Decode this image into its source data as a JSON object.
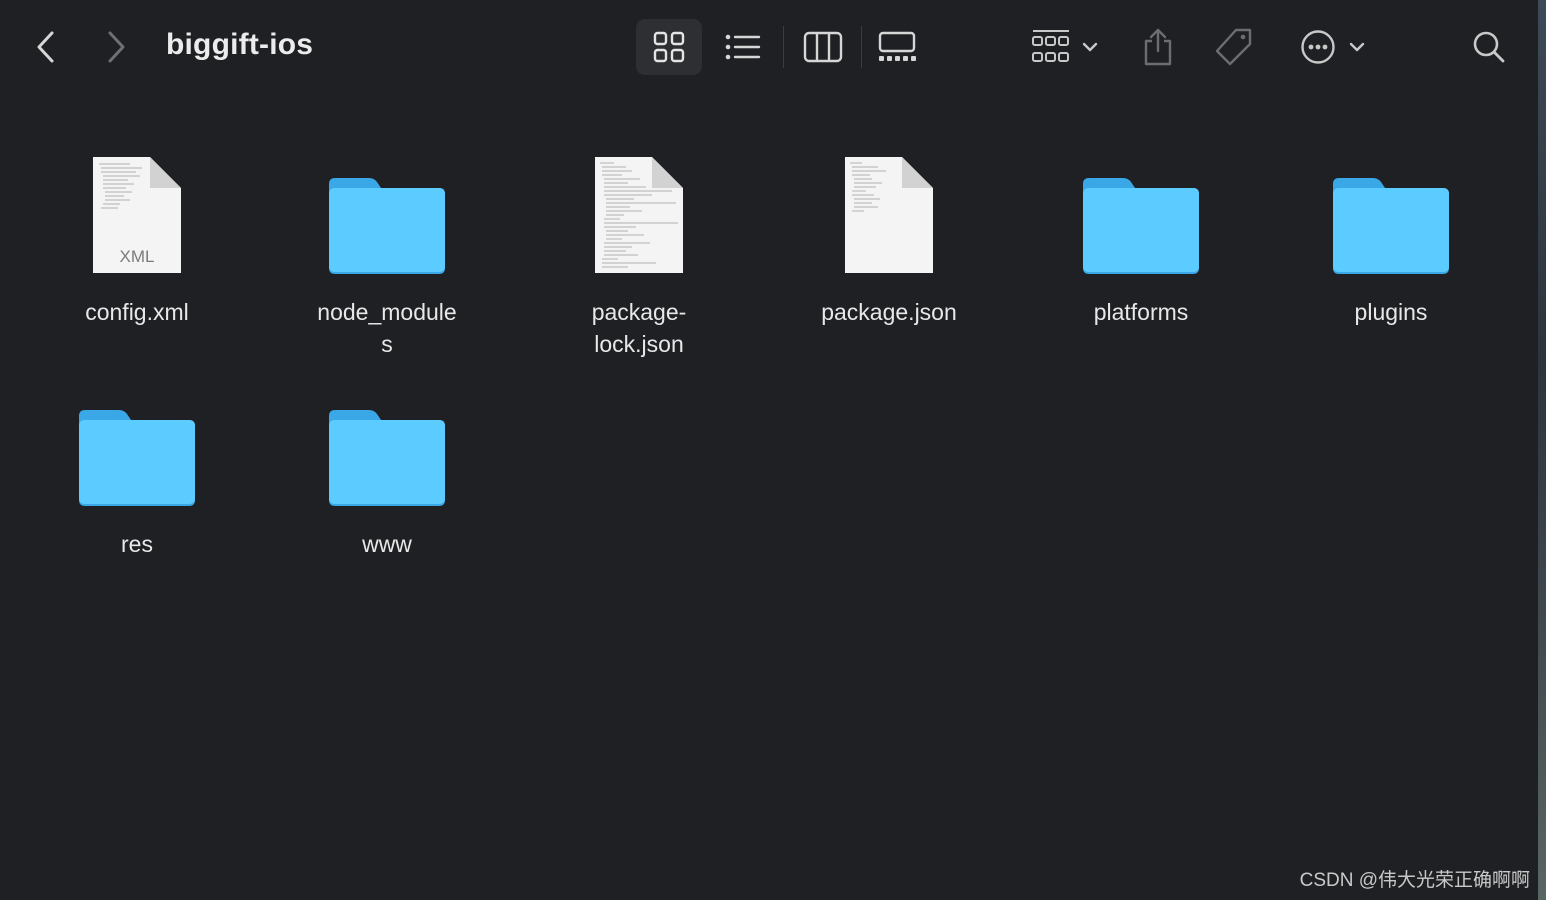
{
  "window": {
    "title": "biggift-ios"
  },
  "toolbar": {
    "back_icon": "chevron-left-icon",
    "forward_icon": "chevron-right-icon",
    "views": [
      "icon-view",
      "list-view",
      "column-view",
      "gallery-view"
    ],
    "active_view": "icon-view",
    "group_icon": "group-by-icon",
    "share_icon": "share-icon",
    "tag_icon": "tag-icon",
    "more_icon": "more-actions-icon",
    "search_icon": "search-icon"
  },
  "items": [
    {
      "name": "config.xml",
      "kind": "xml-file",
      "badge": "XML"
    },
    {
      "name": "node_modules",
      "kind": "folder"
    },
    {
      "name": "package-lock.json",
      "kind": "text-file"
    },
    {
      "name": "package.json",
      "kind": "text-file"
    },
    {
      "name": "platforms",
      "kind": "folder"
    },
    {
      "name": "plugins",
      "kind": "folder"
    },
    {
      "name": "res",
      "kind": "folder"
    },
    {
      "name": "www",
      "kind": "folder"
    }
  ],
  "watermark": "CSDN @伟大光荣正确啊啊",
  "colors": {
    "background": "#1f2023",
    "folder": "#5ccbff",
    "folder_shadow": "#3aa7e6",
    "text": "#e8e8e8",
    "selected_view_bg": "#2e2f33"
  }
}
